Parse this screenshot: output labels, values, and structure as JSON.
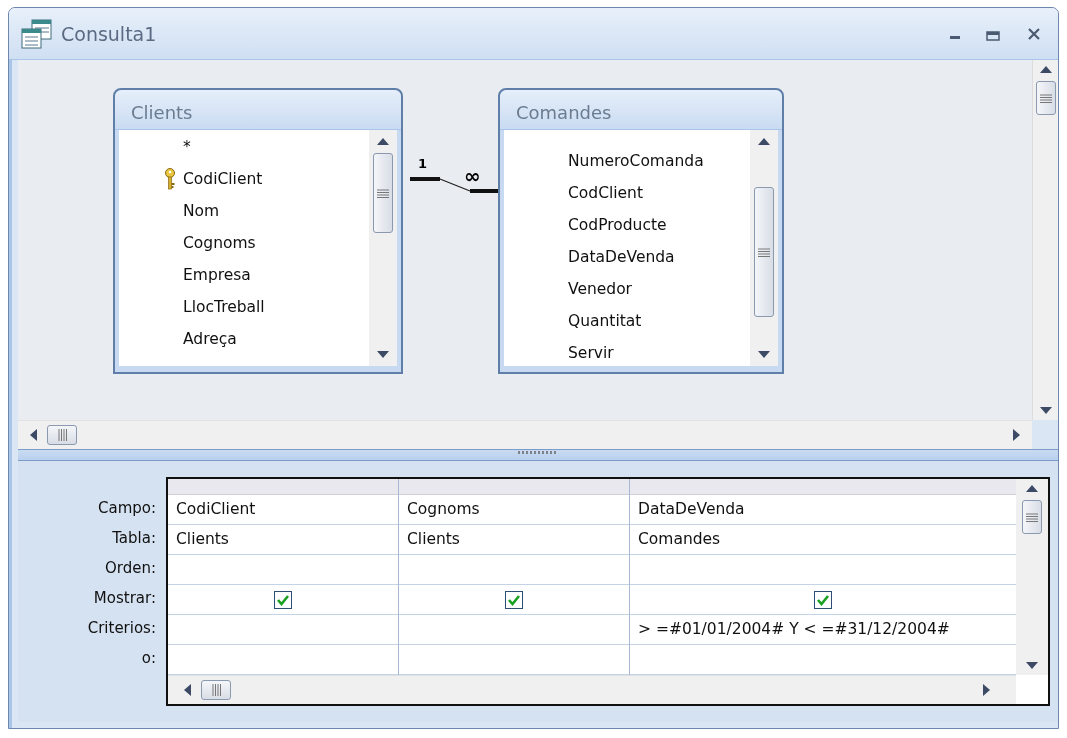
{
  "window": {
    "title": "Consulta1"
  },
  "tables": [
    {
      "name": "Clients",
      "fields": [
        {
          "name": "*",
          "key": false
        },
        {
          "name": "CodiClient",
          "key": true
        },
        {
          "name": "Nom",
          "key": false
        },
        {
          "name": "Cognoms",
          "key": false
        },
        {
          "name": "Empresa",
          "key": false
        },
        {
          "name": "LlocTreball",
          "key": false
        },
        {
          "name": "Adreça",
          "key": false
        }
      ]
    },
    {
      "name": "Comandes",
      "fields": [
        {
          "name": "NumeroComanda",
          "key": false
        },
        {
          "name": "CodClient",
          "key": false
        },
        {
          "name": "CodProducte",
          "key": false
        },
        {
          "name": "DataDeVenda",
          "key": false
        },
        {
          "name": "Venedor",
          "key": false
        },
        {
          "name": "Quantitat",
          "key": false
        },
        {
          "name": "Servir",
          "key": false
        }
      ]
    }
  ],
  "relationship": {
    "one_label": "1",
    "many_label": "∞"
  },
  "grid": {
    "row_labels": [
      "Campo:",
      "Tabla:",
      "Orden:",
      "Mostrar:",
      "Criterios:",
      "o:"
    ],
    "columns": [
      {
        "campo": "CodiClient",
        "tabla": "Clients",
        "mostrar": true
      },
      {
        "campo": "Cognoms",
        "tabla": "Clients",
        "mostrar": true
      },
      {
        "campo": "DataDeVenda",
        "tabla": "Comandes",
        "mostrar": true,
        "criterios": "> =#01/01/2004# Y < =#31/12/2004#"
      }
    ]
  }
}
